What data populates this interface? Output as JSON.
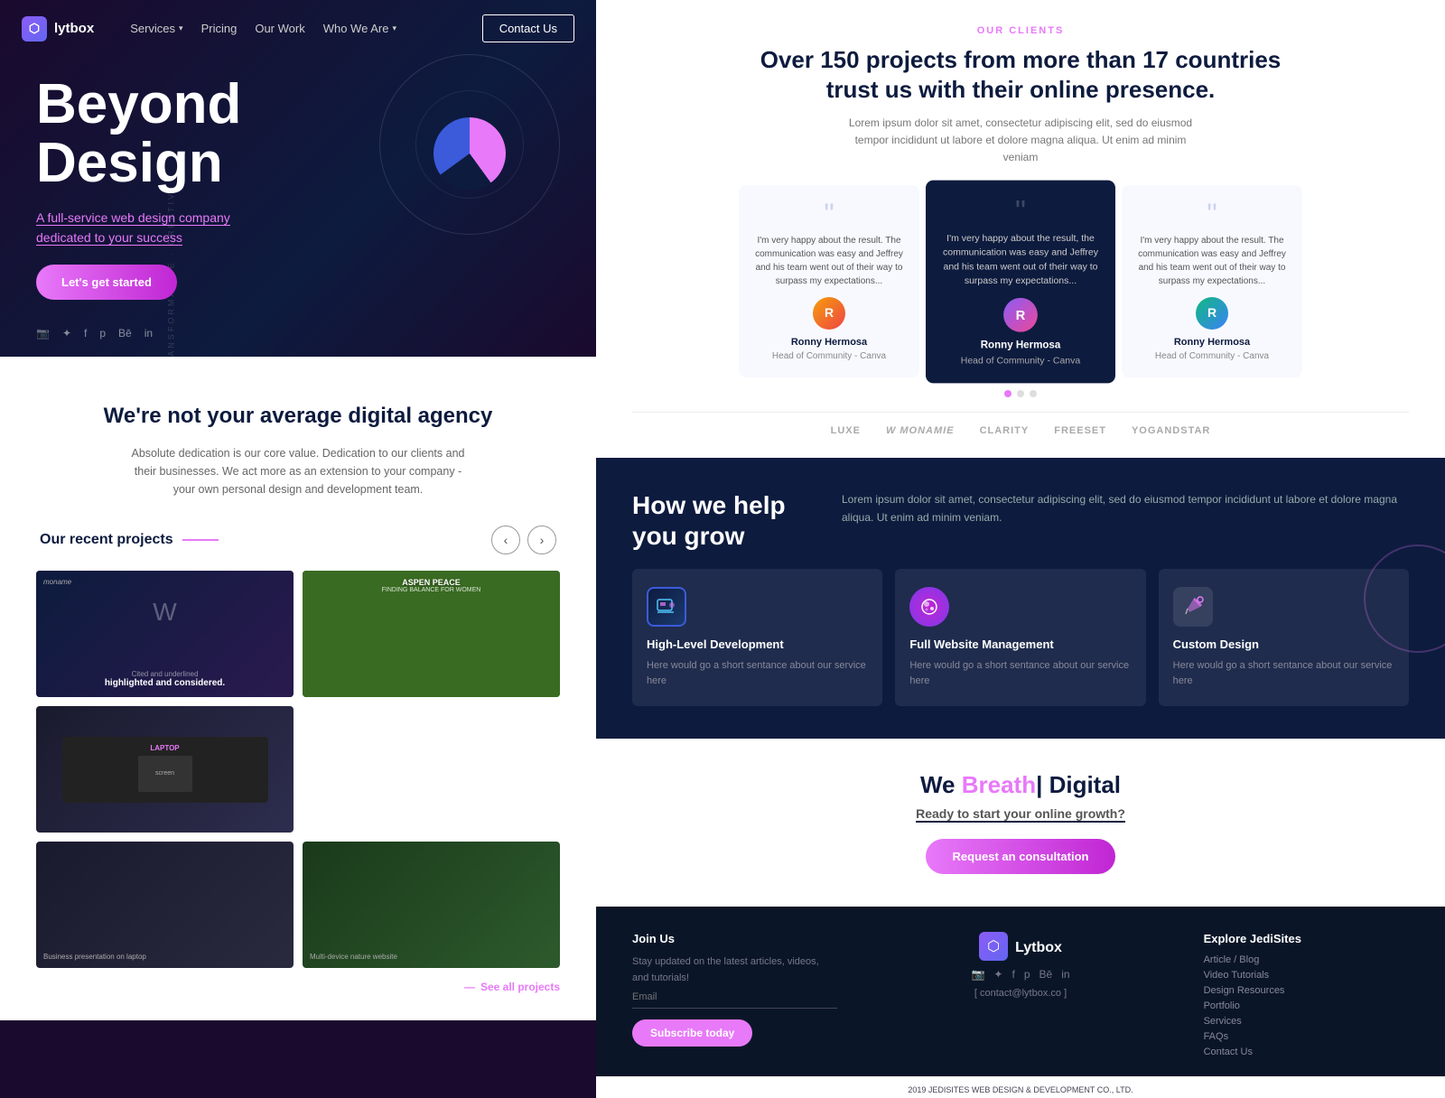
{
  "hero": {
    "logo_text": "lytbox",
    "nav_services": "Services",
    "nav_pricing": "Pricing",
    "nav_work": "Our Work",
    "nav_who": "Who We Are",
    "nav_contact": "Contact Us",
    "title_line1": "Beyond",
    "title_line2": "Design",
    "subtitle": "A full-service web design company",
    "subtitle_bold": "dedicated",
    "subtitle_end": " to your success",
    "cta_btn": "Let's get started",
    "social": [
      "instagram",
      "twitter",
      "facebook",
      "pinterest",
      "behance",
      "linkedin"
    ]
  },
  "agency": {
    "title": "We're not your average digital agency",
    "description": "Absolute dedication is our core value. Dedication to our clients and their businesses. We act more as an extension to your company - your own personal design and development team.",
    "recent_projects_label": "Our recent projects",
    "see_all": "See all projects"
  },
  "clients": {
    "label": "OUR CLIENTS",
    "title_line1": "Over 150 projects from more than 17 countries",
    "title_line2": "trust us with their online presence.",
    "description": "Lorem ipsum dolor sit amet, consectetur adipiscing elit, sed do eiusmod tempor incididunt ut labore et dolore magna aliqua. Ut enim ad minim veniam",
    "testimonials": [
      {
        "quote": "\"I'm very happy about the result. The communication was easy and Jeffrey and his team went out of their way to surpass my expectations...\"",
        "name": "Ronny Hermosa",
        "role": "Head of Community - Canva",
        "avatar": "R"
      },
      {
        "quote": "\"I'm very happy about the result, the communication was easy and Jeffrey and his team went out of their way to surpass my expectations...\"",
        "name": "Ronny Hermosa",
        "role": "Head of Community - Canva",
        "avatar": "R"
      },
      {
        "quote": "\"I'm very happy about the result. The communication was easy and Jeffrey and his team went out of their way to surpass my expectations...\"",
        "name": "Ronny Hermosa",
        "role": "Head of Community - Canva",
        "avatar": "R"
      }
    ],
    "brands": [
      "LUXE",
      "MONAMIE",
      "CLARITY",
      "freeset",
      "YOGANDSTAR"
    ]
  },
  "grow": {
    "title_line1": "How we help",
    "title_line2": "you grow",
    "description": "Lorem ipsum dolor sit amet, consectetur adipiscing elit, sed do eiusmod tempor incididunt ut labore et dolore magna aliqua. Ut enim ad minim veniam.",
    "services": [
      {
        "name": "High-Level Development",
        "description": "Here would go a short sentance about our service here",
        "icon": "💻"
      },
      {
        "name": "Full Website Management",
        "description": "Here would go a short sentance about our service here",
        "icon": "⬡"
      },
      {
        "name": "Custom Design",
        "description": "Here would go a short sentance about our service here",
        "icon": "✏️"
      }
    ]
  },
  "cta": {
    "title_prefix": "We ",
    "title_highlight": "Breath",
    "title_suffix": "| Digital",
    "subtitle_prefix": "Ready to start your ",
    "subtitle_link": "online growth?",
    "btn_label": "Request an consultation"
  },
  "footer": {
    "join_label": "Join Us",
    "join_text": "Stay updated on the latest articles, videos, and tutorials!",
    "email_placeholder": "Email",
    "subscribe_btn": "Subscribe today",
    "logo": "Lytbox",
    "email_contact": "[ contact@lytbox.co ]",
    "explore_label": "Explore JediSites",
    "explore_links": [
      "Article / Blog",
      "Video Tutorials",
      "Design Resources",
      "Portfolio",
      "Services",
      "FAQs",
      "Contact Us"
    ],
    "copyright": "2019 JEDISITES WEB DESIGN & DEVELOPMENT CO., LTD."
  },
  "colors": {
    "accent": "#e879f9",
    "dark": "#0d1b3e",
    "bg_dark": "#1a0a2e"
  }
}
